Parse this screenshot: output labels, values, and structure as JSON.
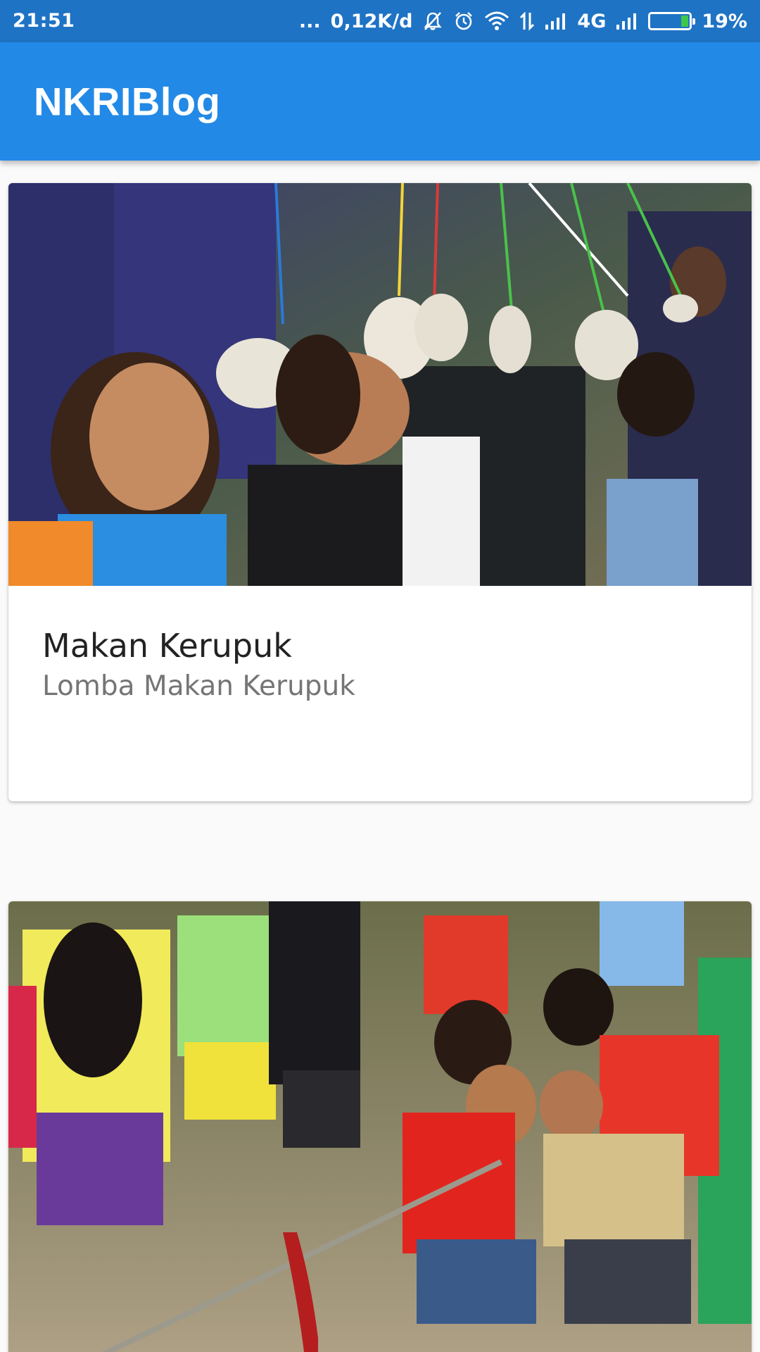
{
  "status_bar": {
    "time": "21:51",
    "dots": "...",
    "network_speed": "0,12K/d",
    "icons": [
      "mute-bell-icon",
      "alarm-icon",
      "wifi-icon",
      "data-arrows-icon",
      "signal-icon",
      "signal-icon"
    ],
    "network_type": "4G",
    "battery_percent": "19%",
    "battery_level": 0.19
  },
  "app_bar": {
    "title": "NKRIBlog",
    "color": "#2389e6"
  },
  "posts": [
    {
      "title": "Makan Kerupuk",
      "subtitle": "Lomba Makan Kerupuk",
      "image_alt": "photo-kids-eating-crackers"
    },
    {
      "title": "",
      "subtitle": "",
      "image_alt": "photo-kids-tug-of-war"
    }
  ]
}
